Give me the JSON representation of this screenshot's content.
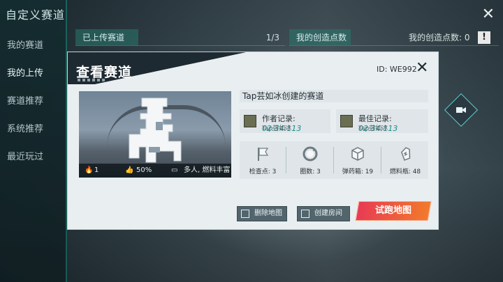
{
  "sidebar": {
    "title": "自定义赛道",
    "items": [
      {
        "label": "我的赛道"
      },
      {
        "label": "我的上传"
      },
      {
        "label": "赛道推荐"
      },
      {
        "label": "系统推荐"
      },
      {
        "label": "最近玩过"
      }
    ]
  },
  "topbar": {
    "uploaded_label": "已上传赛道",
    "uploaded_count": "1/3",
    "points_tab": "我的创造点数",
    "points_label": "我的创造点数: 0",
    "warn": "!"
  },
  "modal": {
    "title": "查看赛道",
    "id": "ID: WE992",
    "track_name": "Tap芸如冰创建的赛道",
    "preview": {
      "likes_count": "1",
      "rating": "50%",
      "tags": "多人, 燃料丰富"
    },
    "author_record": {
      "label": "作者记录: ",
      "time": "02:34:113",
      "player": "Tap芸如冰"
    },
    "best_record": {
      "label": "最佳记录: ",
      "time": "02:34:113",
      "player": "Tap芸如冰"
    },
    "stats": [
      {
        "icon": "flag-icon",
        "label": "检查点: 3"
      },
      {
        "icon": "laps-icon",
        "label": "圈数: 3"
      },
      {
        "icon": "ammo-box-icon",
        "label": "弹药箱: 19"
      },
      {
        "icon": "fuel-bottle-icon",
        "label": "燃料瓶: 48"
      }
    ],
    "buttons": {
      "delete": "删除地图",
      "create_room": "创建房间",
      "test_run": "试跑地图"
    }
  },
  "colors": {
    "accent_teal": "#1a8f8a",
    "primary_button_start": "#e83a55",
    "primary_button_end": "#f27a2a"
  }
}
